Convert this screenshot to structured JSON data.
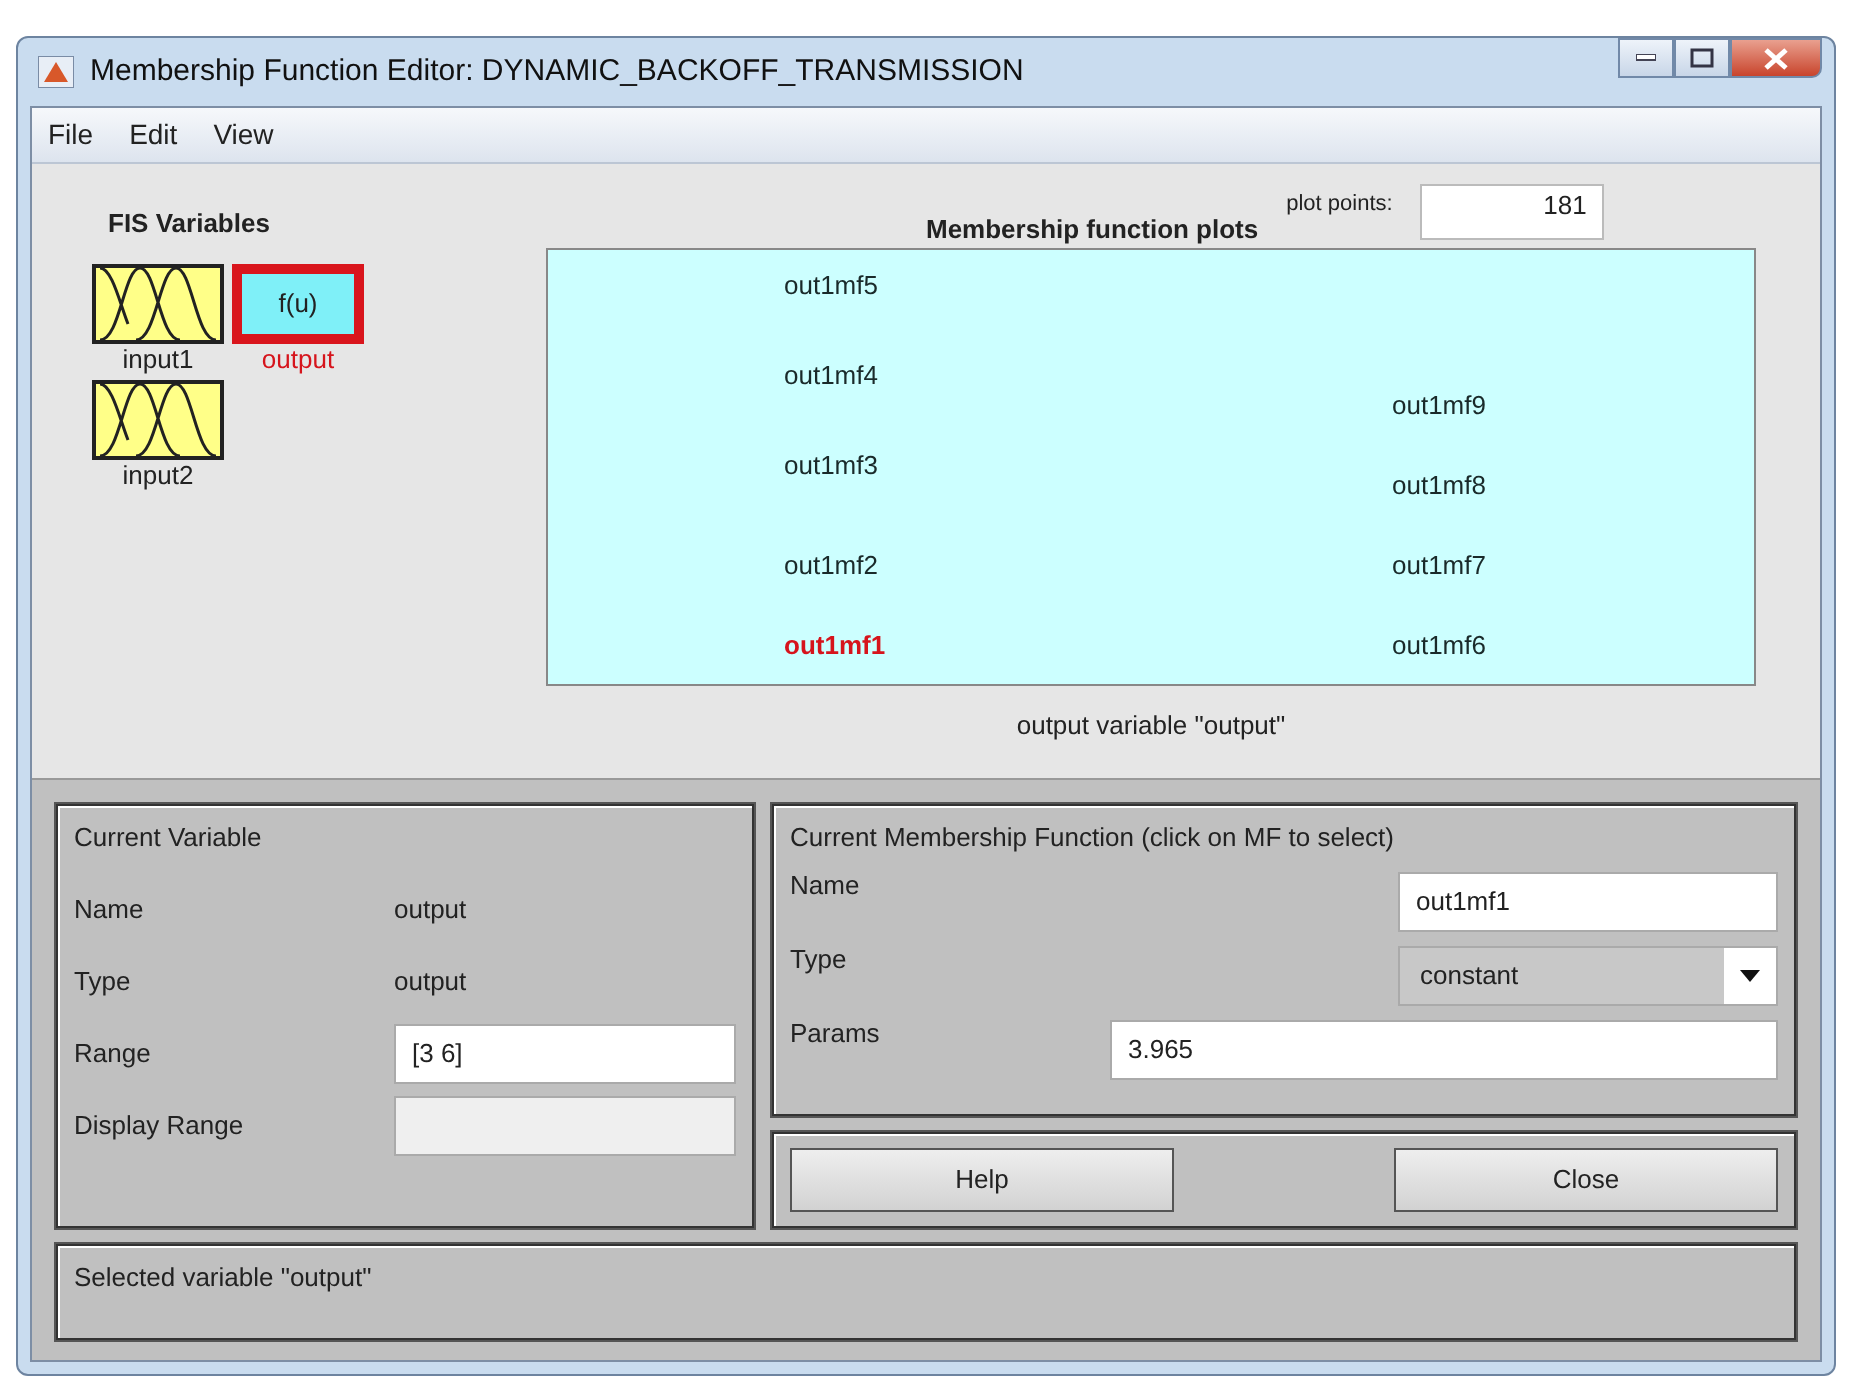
{
  "window": {
    "title": "Membership Function Editor: DYNAMIC_BACKOFF_TRANSMISSION"
  },
  "menu": [
    "File",
    "Edit",
    "View"
  ],
  "fis_variables": {
    "title": "FIS Variables",
    "items": [
      {
        "label": "input1",
        "kind": "input",
        "selected": false
      },
      {
        "label": "output",
        "kind": "output",
        "selected": true,
        "icon_text": "f(u)"
      },
      {
        "label": "input2",
        "kind": "input",
        "selected": false
      }
    ]
  },
  "plot": {
    "title": "Membership function plots",
    "plot_points_label": "plot points:",
    "plot_points": "181",
    "caption": "output variable \"output\"",
    "functions": [
      {
        "label": "out1mf5",
        "selected": false
      },
      {
        "label": "out1mf4",
        "selected": false
      },
      {
        "label": "out1mf9",
        "selected": false
      },
      {
        "label": "out1mf3",
        "selected": false
      },
      {
        "label": "out1mf8",
        "selected": false
      },
      {
        "label": "out1mf2",
        "selected": false
      },
      {
        "label": "out1mf7",
        "selected": false
      },
      {
        "label": "out1mf1",
        "selected": true
      },
      {
        "label": "out1mf6",
        "selected": false
      }
    ]
  },
  "current_variable": {
    "title": "Current Variable",
    "name_label": "Name",
    "name": "output",
    "type_label": "Type",
    "type": "output",
    "range_label": "Range",
    "range": "[3 6]",
    "display_range_label": "Display Range"
  },
  "current_mf": {
    "title": "Current Membership Function (click on MF to select)",
    "name_label": "Name",
    "name": "out1mf1",
    "type_label": "Type",
    "type": "constant",
    "params_label": "Params",
    "params": "3.965"
  },
  "buttons": [
    "Help",
    "Close"
  ],
  "status_bar": "Selected variable \"output\""
}
